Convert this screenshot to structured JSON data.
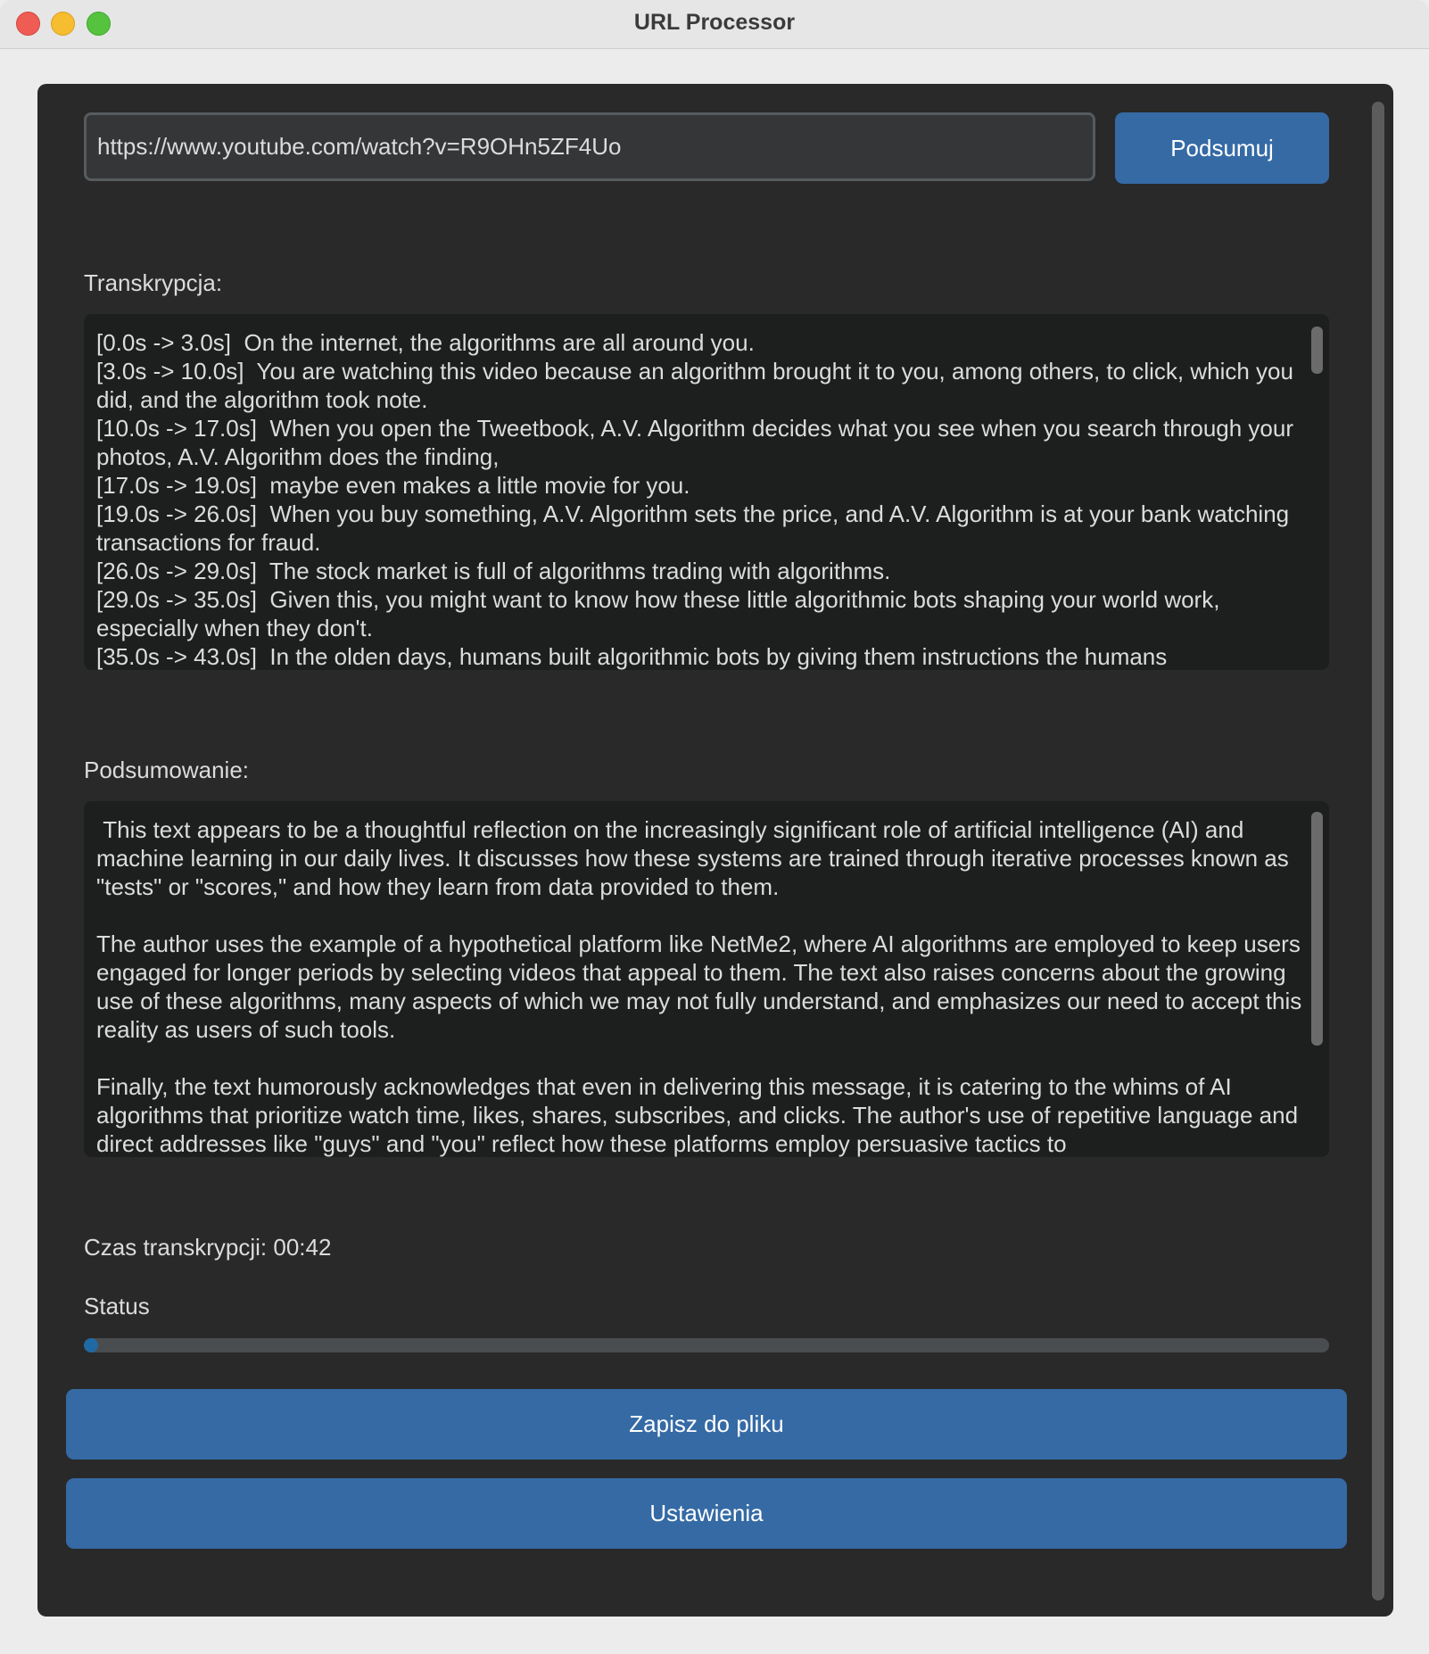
{
  "window": {
    "title": "URL Processor"
  },
  "url_input": {
    "value": "https://www.youtube.com/watch?v=R9OHn5ZF4Uo"
  },
  "buttons": {
    "summarize": "Podsumuj",
    "save": "Zapisz do pliku",
    "settings": "Ustawienia"
  },
  "transcription": {
    "label": "Transkrypcja:",
    "text": "[0.0s -> 3.0s]  On the internet, the algorithms are all around you.\n[3.0s -> 10.0s]  You are watching this video because an algorithm brought it to you, among others, to click, which you did, and the algorithm took note.\n[10.0s -> 17.0s]  When you open the Tweetbook, A.V. Algorithm decides what you see when you search through your photos, A.V. Algorithm does the finding,\n[17.0s -> 19.0s]  maybe even makes a little movie for you.\n[19.0s -> 26.0s]  When you buy something, A.V. Algorithm sets the price, and A.V. Algorithm is at your bank watching transactions for fraud.\n[26.0s -> 29.0s]  The stock market is full of algorithms trading with algorithms.\n[29.0s -> 35.0s]  Given this, you might want to know how these little algorithmic bots shaping your world work, especially when they don't.\n[35.0s -> 43.0s]  In the olden days, humans built algorithmic bots by giving them instructions the humans"
  },
  "summary": {
    "label": "Podsumowanie:",
    "text": " This text appears to be a thoughtful reflection on the increasingly significant role of artificial intelligence (AI) and machine learning in our daily lives. It discusses how these systems are trained through iterative processes known as \"tests\" or \"scores,\" and how they learn from data provided to them.\n\nThe author uses the example of a hypothetical platform like NetMe2, where AI algorithms are employed to keep users engaged for longer periods by selecting videos that appeal to them. The text also raises concerns about the growing use of these algorithms, many aspects of which we may not fully understand, and emphasizes our need to accept this reality as users of such tools.\n\nFinally, the text humorously acknowledges that even in delivering this message, it is catering to the whims of AI algorithms that prioritize watch time, likes, shares, subscribes, and clicks. The author's use of repetitive language and direct addresses like \"guys\" and \"you\" reflect how these platforms employ persuasive tactics to"
  },
  "transcription_time": "Czas transkrypcji: 00:42",
  "status": {
    "label": "Status",
    "progress": 0.01
  },
  "colors": {
    "panel": "#292929",
    "accent": "#356aa5",
    "progress_fill": "#1f6aa5",
    "text": "#dcdcdc"
  }
}
